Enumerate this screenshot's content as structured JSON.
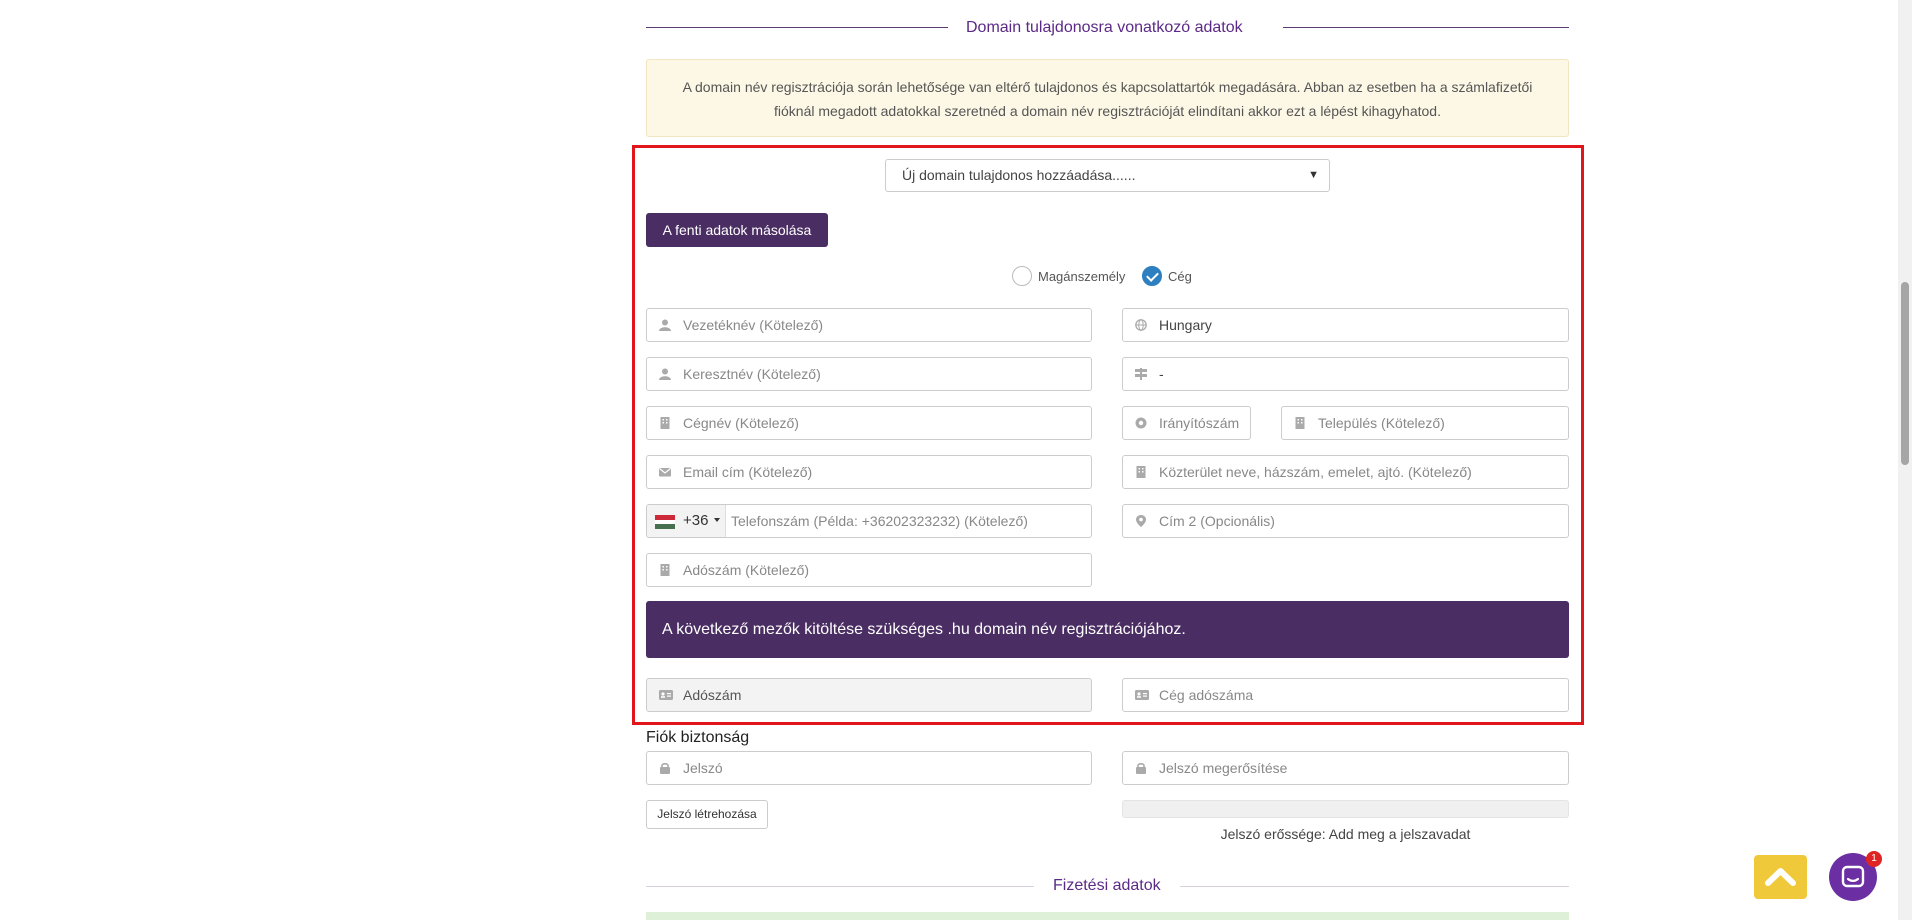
{
  "owner_section": {
    "title": "Domain tulajdonosra vonatkozó adatok",
    "info": "A domain név regisztrációja során lehetősége van eltérő tulajdonos és kapcsolattartók megadására. Abban az esetben ha a számlafizetői fióknál megadott adatokkal szeretnéd a domain név regisztrációját elindítani akkor ezt a lépést kihagyhatod.",
    "owner_select": "Új domain tulajdonos hozzáadása......",
    "copy_button": "A fenti adatok másolása",
    "radio_private": "Magánszemély",
    "radio_company": "Cég",
    "selected_type": "Cég"
  },
  "form": {
    "lastname": "Vezetéknév (Kötelező)",
    "country": "Hungary",
    "firstname": "Keresztnév (Kötelező)",
    "state": "-",
    "company": "Cégnév (Kötelező)",
    "zip": "Irányítószám",
    "city": "Település (Kötelező)",
    "email": "Email cím (Kötelező)",
    "address1": "Közterület neve, házszám, emelet, ajtó. (Kötelező)",
    "dial_code": "+36",
    "phone": "Telefonszám (Példa: +36202323232) (Kötelező)",
    "address2": "Cím 2 (Opcionális)",
    "taxid": "Adószám (Kötelező)"
  },
  "hu_banner": "A következő mezők kitöltése szükséges .hu domain név regisztrációjához.",
  "hu_fields": {
    "taxid_disabled": "Adószám",
    "company_taxid": "Cég adószáma"
  },
  "security": {
    "title": "Fiók biztonság",
    "password": "Jelszó",
    "password_confirm": "Jelszó megerősítése",
    "generate_button": "Jelszó létrehozása",
    "strength": "Jelszó erőssége: Add meg a jelszavadat"
  },
  "payment_section": {
    "title": "Fizetési adatok"
  },
  "chat_badge": "1",
  "colors": {
    "brand_purple": "#4a2d62",
    "accent_title": "#5b2a86",
    "highlight_frame": "#e0161a",
    "radio_checked": "#2e7fc0",
    "to_top": "#f0c93a"
  }
}
